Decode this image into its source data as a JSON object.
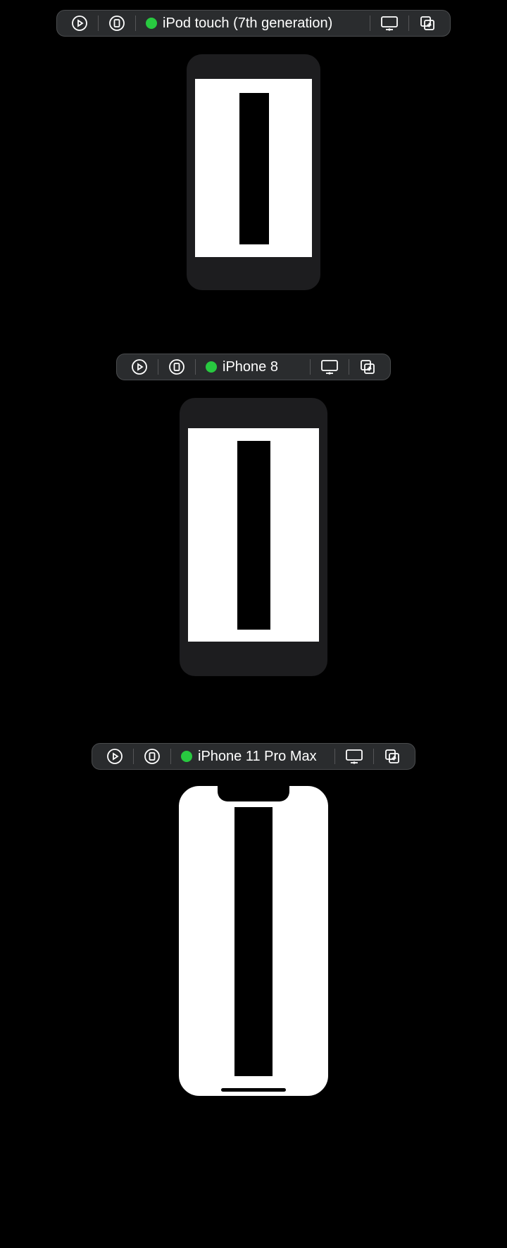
{
  "colors": {
    "status_active": "#28c940"
  },
  "previews": [
    {
      "device_label": "iPod touch (7th generation)"
    },
    {
      "device_label": "iPhone 8"
    },
    {
      "device_label": "iPhone 11 Pro Max"
    }
  ]
}
